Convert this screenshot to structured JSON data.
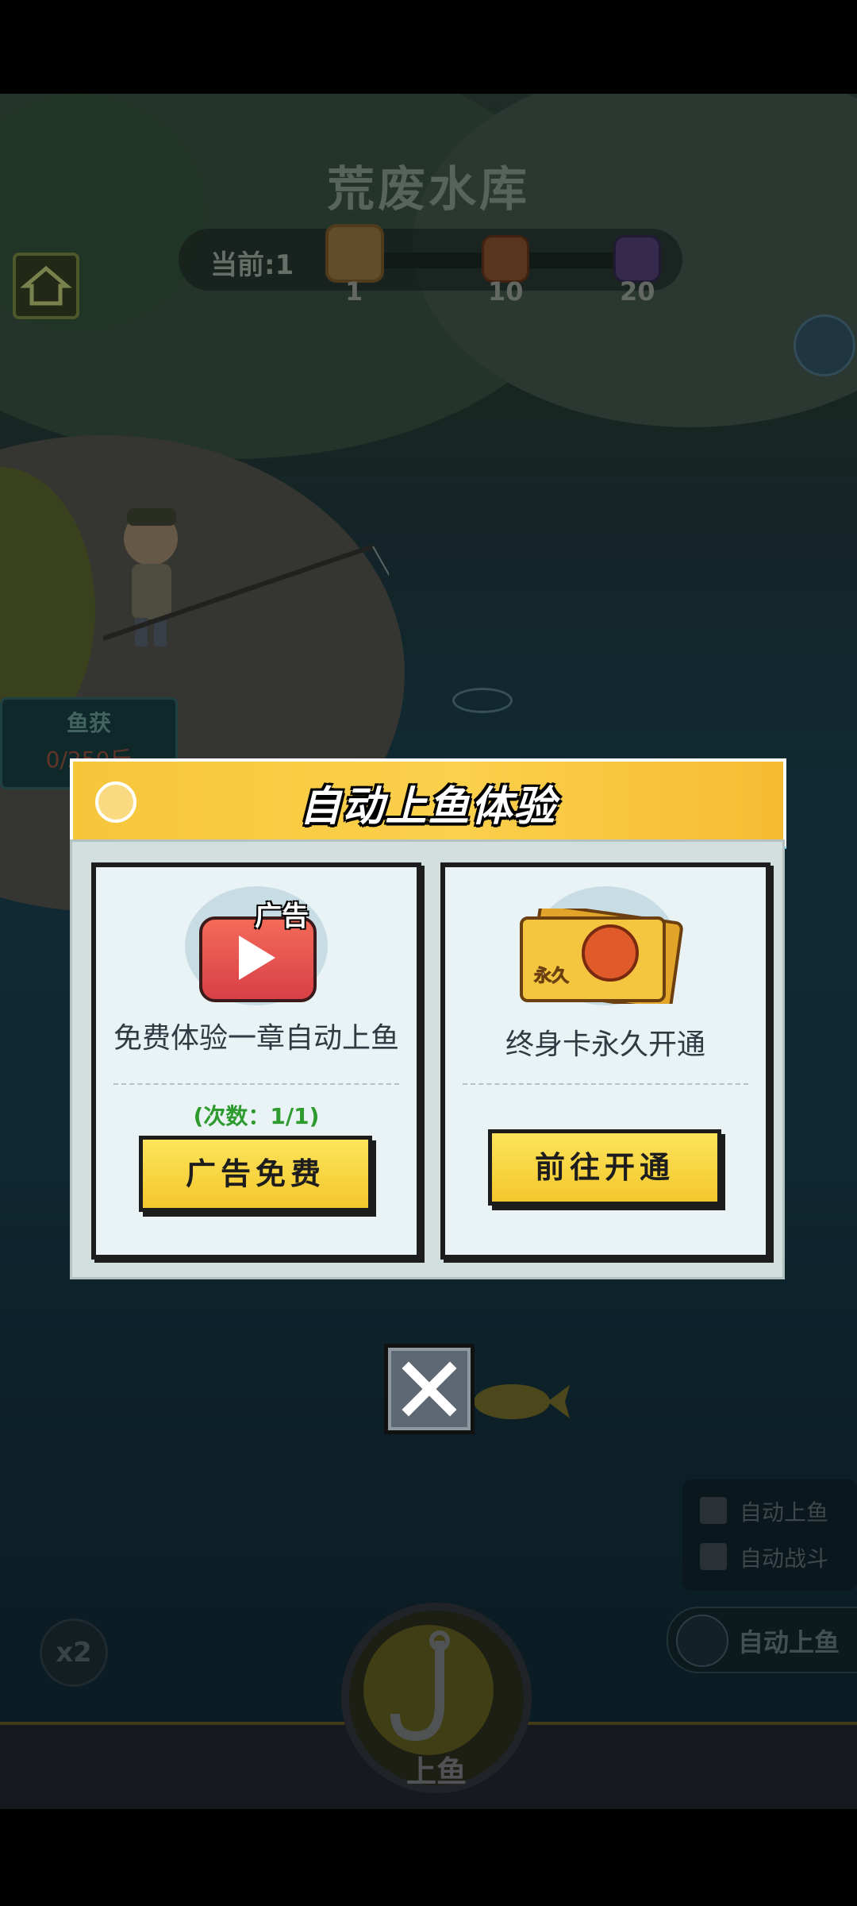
{
  "game": {
    "location_title": "荒废水库",
    "progress": {
      "current_label": "当前:1",
      "milestones": [
        "1",
        "10",
        "20"
      ]
    },
    "catch": {
      "title": "鱼获",
      "value": "0/250斤"
    },
    "toggles": [
      {
        "label": "自动上鱼",
        "checked": false
      },
      {
        "label": "自动战斗",
        "checked": false
      }
    ],
    "auto_button_label": "自动上鱼",
    "multiplier_label": "x2",
    "reel_button_label": "上鱼"
  },
  "dialog": {
    "title": "自动上鱼体验",
    "left_card": {
      "badge": "广告",
      "description": "免费体验一章自动上鱼",
      "count_text": "(次数：1/1)",
      "button_label": "广告免费"
    },
    "right_card": {
      "ticket_text": "永久",
      "description": "终身卡永久开通",
      "button_label": "前往开通"
    }
  },
  "colors": {
    "dialog_header": "#f6c63b",
    "button_yellow": "#fde45a",
    "count_green": "#2e9b2e",
    "header_underline": "#3fc6d6"
  }
}
